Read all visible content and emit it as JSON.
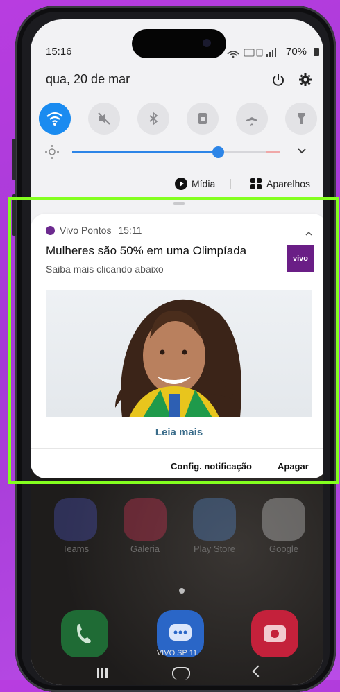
{
  "status_bar": {
    "time": "15:16",
    "battery": "70%"
  },
  "date": "qua, 20 de mar",
  "quick_settings": [
    "wifi-icon",
    "mute-icon",
    "bluetooth-icon",
    "rotation-lock-icon",
    "airplane-icon",
    "flashlight-icon"
  ],
  "media": {
    "label": "Mídia",
    "devices": "Aparelhos"
  },
  "brightness_fraction": 0.7,
  "notification": {
    "app": "Vivo Pontos",
    "time": "15:11",
    "title": "Mulheres são 50% em uma Olimpíada",
    "text": "Saiba mais clicando abaixo",
    "logo": "vivo",
    "cta": "Leia mais",
    "actions": {
      "settings": "Config. notificação",
      "clear": "Apagar"
    }
  },
  "home": {
    "apps": [
      "Teams",
      "Galeria",
      "Play Store",
      "Google"
    ],
    "dock_label": "VIVO SP 11"
  },
  "colors": {
    "accent": "#1a8bf0",
    "highlight": "#84ff1f",
    "brand": "#6a1e86"
  }
}
